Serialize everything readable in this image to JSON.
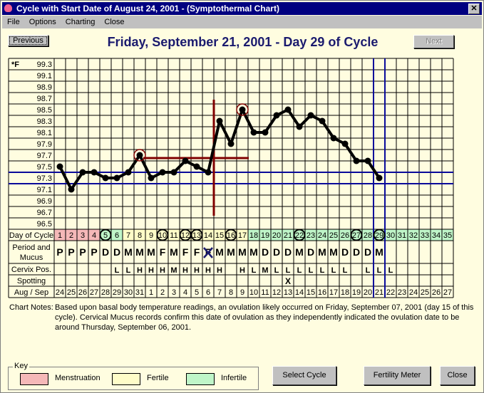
{
  "window": {
    "title": "Cycle with Start Date of August 24, 2001  -  (Symptothermal Chart)",
    "close_glyph": "✕"
  },
  "menu": [
    "File",
    "Options",
    "Charting",
    "Close"
  ],
  "nav": {
    "previous": "Previous",
    "next": "Next",
    "heading": "Friday, September 21, 2001 - Day 29 of Cycle"
  },
  "colors": {
    "menstruation": "#f5b8b8",
    "fertile": "#fffdc8",
    "infertile": "#bff5c8",
    "coverline": "#0a0a9a",
    "ovulation": "#800000",
    "accent": "#1a1a6e"
  },
  "chart_data": {
    "type": "line",
    "unit_label": "*F",
    "y_ticks": [
      "99.3",
      "99.1",
      "98.9",
      "98.7",
      "98.5",
      "98.3",
      "98.1",
      "97.9",
      "97.7",
      "97.5",
      "97.3",
      "97.1",
      "96.9",
      "96.7",
      "96.5"
    ],
    "ylim": [
      96.5,
      99.3
    ],
    "days": [
      1,
      2,
      3,
      4,
      5,
      6,
      7,
      8,
      9,
      10,
      11,
      12,
      13,
      14,
      15,
      16,
      17,
      18,
      19,
      20,
      21,
      22,
      23,
      24,
      25,
      26,
      27,
      28,
      29,
      30,
      31,
      32,
      33,
      34,
      35
    ],
    "temperatures": [
      97.5,
      97.1,
      97.4,
      97.4,
      97.3,
      97.3,
      97.4,
      97.7,
      97.3,
      97.4,
      97.4,
      97.6,
      97.5,
      97.4,
      98.3,
      97.9,
      98.5,
      98.1,
      98.1,
      98.4,
      98.5,
      98.2,
      98.4,
      98.3,
      98.0,
      97.9,
      97.6,
      97.6,
      97.3
    ],
    "circled_temperature_days": [
      8,
      17
    ],
    "coverlines": [
      97.4,
      97.2
    ],
    "ovulation_day_after": 14,
    "ovulation_level": 97.65,
    "current_day": 29,
    "grid": true
  },
  "rows": {
    "day_label": "Day of Cycle",
    "mucus_label": "Period and Mucus",
    "cervix_label": "Cervix Pos.",
    "spotting_label": "Spotting",
    "date_label": "Aug / Sep",
    "day_phase": [
      "M",
      "M",
      "M",
      "M",
      "I",
      "I",
      "F",
      "F",
      "F",
      "F",
      "F",
      "F",
      "F",
      "F",
      "F",
      "F",
      "F",
      "I",
      "I",
      "I",
      "I",
      "I",
      "I",
      "I",
      "I",
      "I",
      "I",
      "I",
      "I",
      "I",
      "I",
      "I",
      "I",
      "I",
      "I"
    ],
    "circled_days": [
      5,
      10,
      12,
      13,
      16,
      22,
      27,
      29
    ],
    "mucus": [
      "P",
      "P",
      "P",
      "P",
      "D",
      "D",
      "M",
      "M",
      "M",
      "F",
      "M",
      "F",
      "F",
      "F",
      "M",
      "M",
      "M",
      "M",
      "D",
      "D",
      "D",
      "M",
      "D",
      "M",
      "M",
      "D",
      "D",
      "D",
      "M",
      "",
      "",
      "",
      "",
      "",
      ""
    ],
    "peak_day": 14,
    "cervix": [
      "",
      "",
      "",
      "",
      "",
      "L",
      "L",
      "H",
      "H",
      "H",
      "M",
      "H",
      "H",
      "H",
      "H",
      "",
      "H",
      "L",
      "M",
      "L",
      "L",
      "L",
      "L",
      "L",
      "L",
      "L",
      "",
      "L",
      "L",
      "L",
      "",
      "",
      "",
      "",
      ""
    ],
    "spotting": [
      "",
      "",
      "",
      "",
      "",
      "",
      "",
      "",
      "",
      "",
      "",
      "",
      "",
      "",
      "",
      "",
      "",
      "",
      "",
      "",
      "X",
      "",
      "",
      "",
      "",
      "",
      "",
      "",
      "",
      "",
      "",
      "",
      "",
      "",
      ""
    ],
    "dates": [
      "24",
      "25",
      "26",
      "27",
      "28",
      "29",
      "30",
      "31",
      "1",
      "2",
      "3",
      "4",
      "5",
      "6",
      "7",
      "8",
      "9",
      "10",
      "11",
      "12",
      "13",
      "14",
      "15",
      "16",
      "17",
      "18",
      "19",
      "20",
      "21",
      "22",
      "23",
      "24",
      "25",
      "26",
      "27"
    ]
  },
  "notes": {
    "label": "Chart Notes:",
    "text": "Based upon basal body temperature readings, an ovulation likely occurred on Friday, September 07, 2001 (day 15 of this cycle).  Cervical Mucus records confirm this date of ovulation as they independently indicated the ovulation date to be around Thursday, September 06, 2001."
  },
  "key": {
    "title": "Key",
    "menstruation": "Menstruation",
    "fertile": "Fertile",
    "infertile": "Infertile"
  },
  "buttons": {
    "select_cycle": "Select Cycle",
    "fertility_meter": "Fertility Meter",
    "close": "Close"
  }
}
